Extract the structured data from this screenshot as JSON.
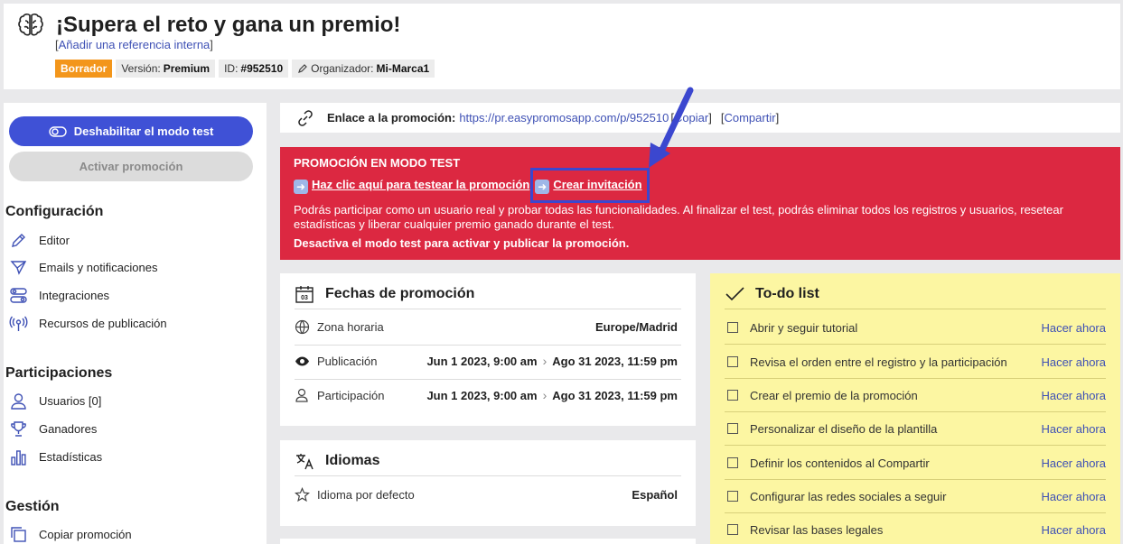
{
  "header": {
    "title": "¡Supera el reto y gana un premio!",
    "ref_open": "[",
    "ref_link": "Añadir una referencia interna",
    "ref_close": "]",
    "badge_status": "Borrador",
    "version_label": "Versión:",
    "version_value": "Premium",
    "id_label": "ID:",
    "id_value": "#952510",
    "organizer_label": "Organizador:",
    "organizer_value": "Mi-Marca1"
  },
  "sidebar": {
    "test_button": "Deshabilitar el modo test",
    "activate_button": "Activar promoción",
    "config_title": "Configuración",
    "config_items": [
      "Editor",
      "Emails y notificaciones",
      "Integraciones",
      "Recursos de publicación"
    ],
    "participations_title": "Participaciones",
    "participations_items": [
      "Usuarios [0]",
      "Ganadores",
      "Estadísticas"
    ],
    "management_title": "Gestión",
    "management_items": [
      "Copiar promoción"
    ]
  },
  "link_bar": {
    "label": "Enlace a la promoción:",
    "url": "https://pr.easypromosapp.com/p/952510",
    "copy": "Copiar",
    "share": "Compartir"
  },
  "alert": {
    "title": "PROMOCIÓN EN MODO TEST",
    "test_link": "Haz clic aquí para testear la promoción",
    "invite_link": "Crear invitación",
    "body": "Podrás participar como un usuario real y probar todas las funcionalidades. Al finalizar el test, podrás eliminar todos los registros y usuarios, resetear estadísticas y liberar cualquier premio ganado durante el test.",
    "bold": "Desactiva el modo test para activar y publicar la promoción."
  },
  "dates": {
    "title": "Fechas de promoción",
    "calendar_day": "03",
    "timezone_label": "Zona horaria",
    "timezone_value": "Europe/Madrid",
    "publication_label": "Publicación",
    "publication_start": "Jun 1 2023, 9:00 am",
    "publication_end": "Ago 31 2023, 11:59 pm",
    "participation_label": "Participación",
    "participation_start": "Jun 1 2023, 9:00 am",
    "participation_end": "Ago 31 2023, 11:59 pm"
  },
  "languages": {
    "title": "Idiomas",
    "default_label": "Idioma por defecto",
    "default_value": "Español"
  },
  "todo": {
    "title": "To-do list",
    "action": "Hacer ahora",
    "items": [
      "Abrir y seguir tutorial",
      "Revisa el orden entre el registro y la participación",
      "Crear el premio de la promoción",
      "Personalizar el diseño de la plantilla",
      "Definir los contenidos al Compartir",
      "Configurar las redes sociales a seguir",
      "Revisar las bases legales"
    ]
  },
  "colors": {
    "accent": "#3f51d6",
    "alert": "#dc2841",
    "draft": "#f3961b",
    "todo_bg": "#fcf6a2"
  }
}
